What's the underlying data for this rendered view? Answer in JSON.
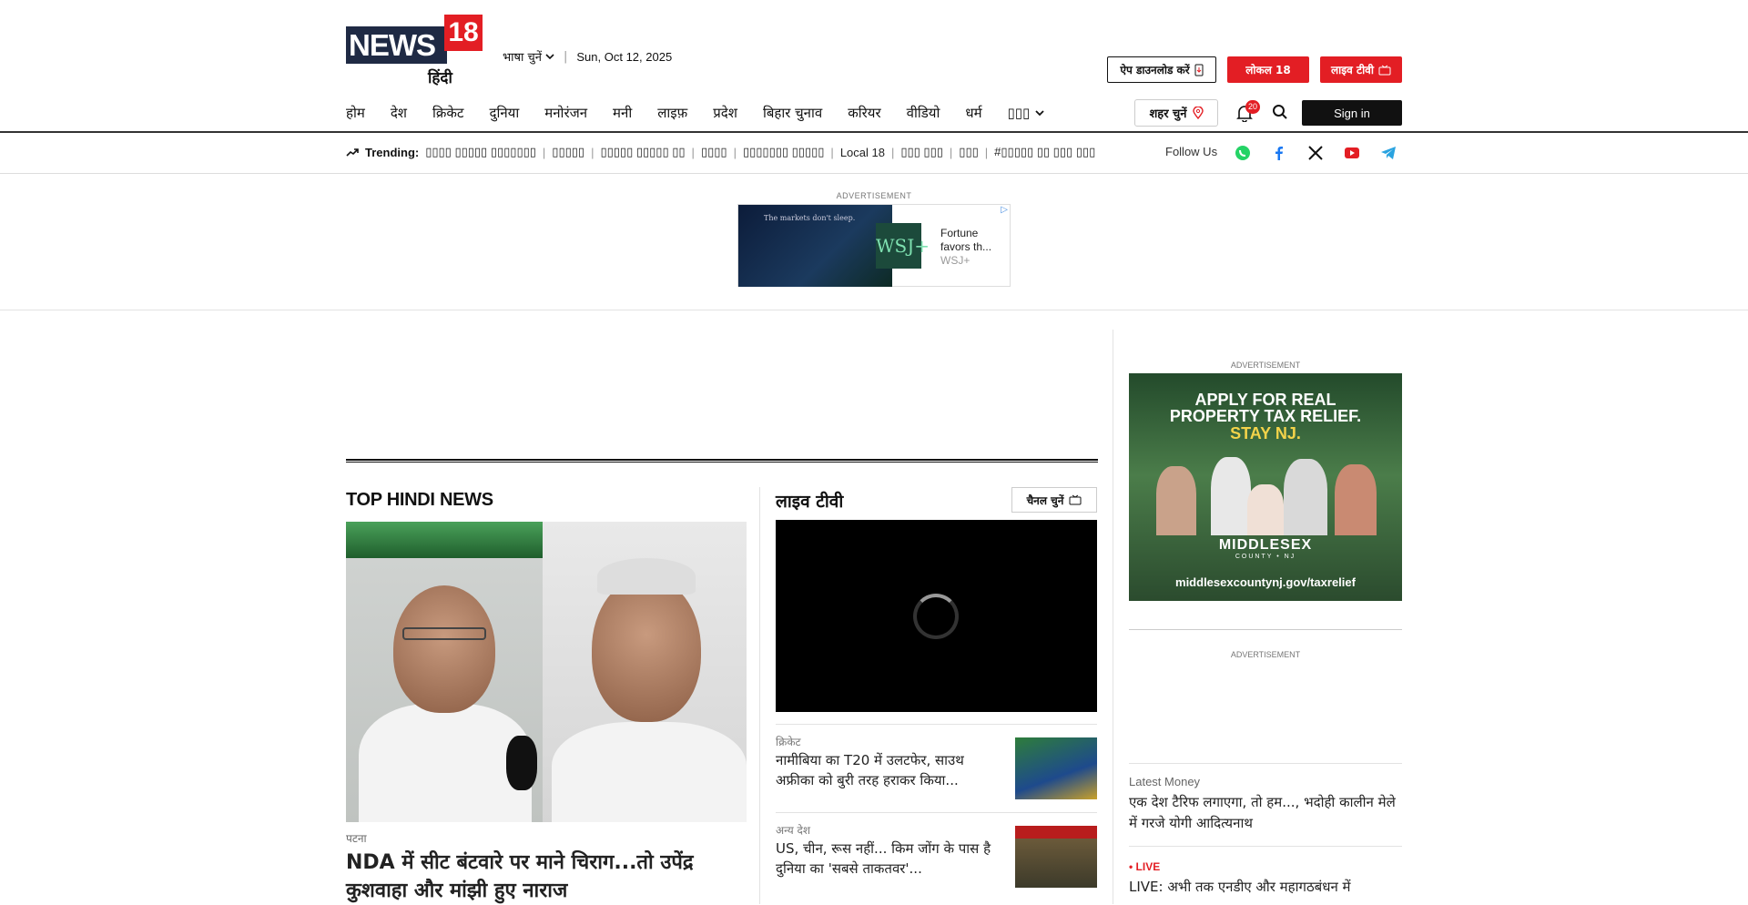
{
  "header": {
    "logo_main": "NEWS",
    "logo_num": "18",
    "logo_sub": "हिंदी",
    "language_label": "भाषा चुनें",
    "date": "Sun, Oct 12, 2025",
    "app_download": "ऐप डाउनलोड करें",
    "local18": "लोकल 18",
    "live_tv": "लाइव टीवी",
    "city_select": "शहर चुनें",
    "notification_count": "20",
    "sign_in": "Sign in"
  },
  "nav": {
    "items": [
      "होम",
      "देश",
      "क्रिकेट",
      "दुनिया",
      "मनोरंजन",
      "मनी",
      "लाइफ़",
      "प्रदेश",
      "बिहार चुनाव",
      "करियर",
      "वीडियो",
      "धर्म",
      "▯▯▯"
    ]
  },
  "trending": {
    "label": "Trending:",
    "items": [
      "▯▯▯▯ ▯▯▯▯▯ ▯▯▯▯▯▯▯",
      "▯▯▯▯▯",
      "▯▯▯▯▯ ▯▯▯▯▯ ▯▯",
      "▯▯▯▯",
      "▯▯▯▯▯▯▯ ▯▯▯▯▯",
      "Local 18",
      "▯▯▯ ▯▯▯",
      "▯▯▯",
      "#▯▯▯▯▯ ▯▯ ▯▯▯ ▯▯▯"
    ],
    "follow_us": "Follow Us",
    "social_icons": [
      "whatsapp-icon",
      "facebook-icon",
      "x-icon",
      "youtube-icon",
      "telegram-icon"
    ]
  },
  "ads": {
    "label": "ADVERTISEMENT",
    "top_ad_tagline": "The markets don't sleep.",
    "top_ad_badge": "WSJ+",
    "top_ad_text": "Fortune favors th...",
    "top_ad_brand": "WSJ+",
    "side_ad_line1": "APPLY FOR REAL PROPERTY TAX RELIEF.",
    "side_ad_line2": "STAY NJ.",
    "side_ad_logo": "MIDDLESEX",
    "side_ad_logo_sub": "COUNTY • NJ",
    "side_ad_url": "middlesexcountynj.gov/taxrelief"
  },
  "top_news": {
    "heading": "TOP HINDI NEWS",
    "category": "पटना",
    "title": "NDA में सीट बंटवारे पर माने चिराग...तो उपेंद्र कुशवाहा और मांझी हुए नाराज"
  },
  "live": {
    "heading": "लाइव टीवी",
    "channel_select": "चैनल चुनें",
    "stories": [
      {
        "category": "क्रिकेट",
        "title": "नामीबिया का T20 में उलटफेर, साउथ अफ्रीका को बुरी तरह हराकर किया..."
      },
      {
        "category": "अन्य देश",
        "title": "US, चीन, रूस नहीं... किम जोंग के पास है दुनिया का 'सबसे ताकतवर'..."
      }
    ]
  },
  "sidebar": {
    "latest_money_category": "Latest Money",
    "latest_money_title": "एक देश टैरिफ लगाएगा, तो हम..., भदोही कालीन मेले में गरजे योगी आदित्यनाथ",
    "live_label": "LIVE",
    "live_title": "LIVE: अभी तक एनडीए और महागठबंधन में"
  },
  "colors": {
    "brand_red": "#e31e24",
    "brand_navy": "#1f2a44"
  }
}
